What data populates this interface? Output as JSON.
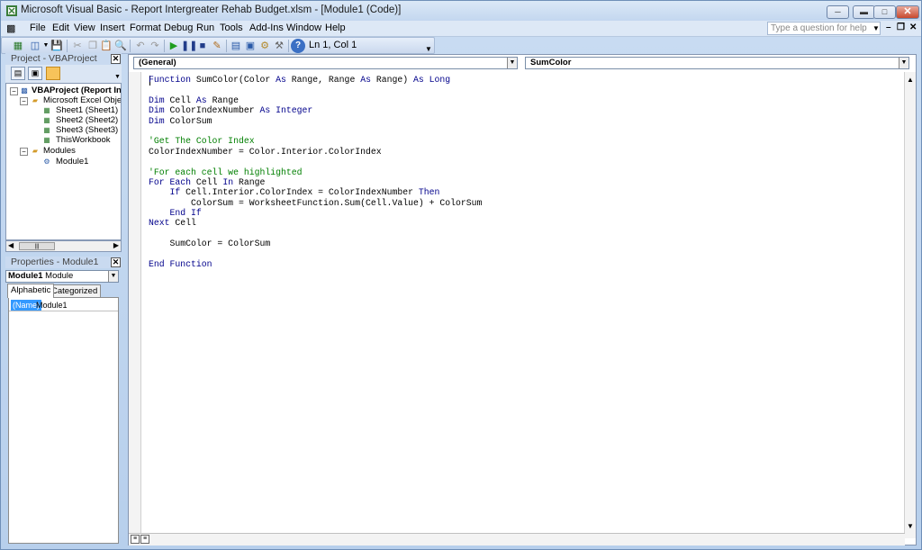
{
  "window": {
    "title": "Microsoft Visual Basic - Report Intergreater Rehab Budget.xlsm - [Module1 (Code)]"
  },
  "menu": [
    "File",
    "Edit",
    "View",
    "Insert",
    "Format",
    "Debug",
    "Run",
    "Tools",
    "Add-Ins",
    "Window",
    "Help"
  ],
  "help": {
    "placeholder": "Type a question for help"
  },
  "toolbar": {
    "position": "Ln 1, Col 1"
  },
  "project": {
    "title": "Project - VBAProject",
    "root": "VBAProject (Report Inte",
    "excel_objects": "Microsoft Excel Objects",
    "sheets": [
      "Sheet1 (Sheet1)",
      "Sheet2 (Sheet2)",
      "Sheet3 (Sheet3)",
      "ThisWorkbook"
    ],
    "modules": "Modules",
    "module1": "Module1"
  },
  "properties": {
    "title": "Properties - Module1",
    "object_name": "Module1",
    "object_type": "Module",
    "tabs": [
      "Alphabetic",
      "Categorized"
    ],
    "row_name": "(Name)",
    "row_value": "Module1"
  },
  "code": {
    "object_combo": "(General)",
    "proc_combo": "SumColor"
  }
}
